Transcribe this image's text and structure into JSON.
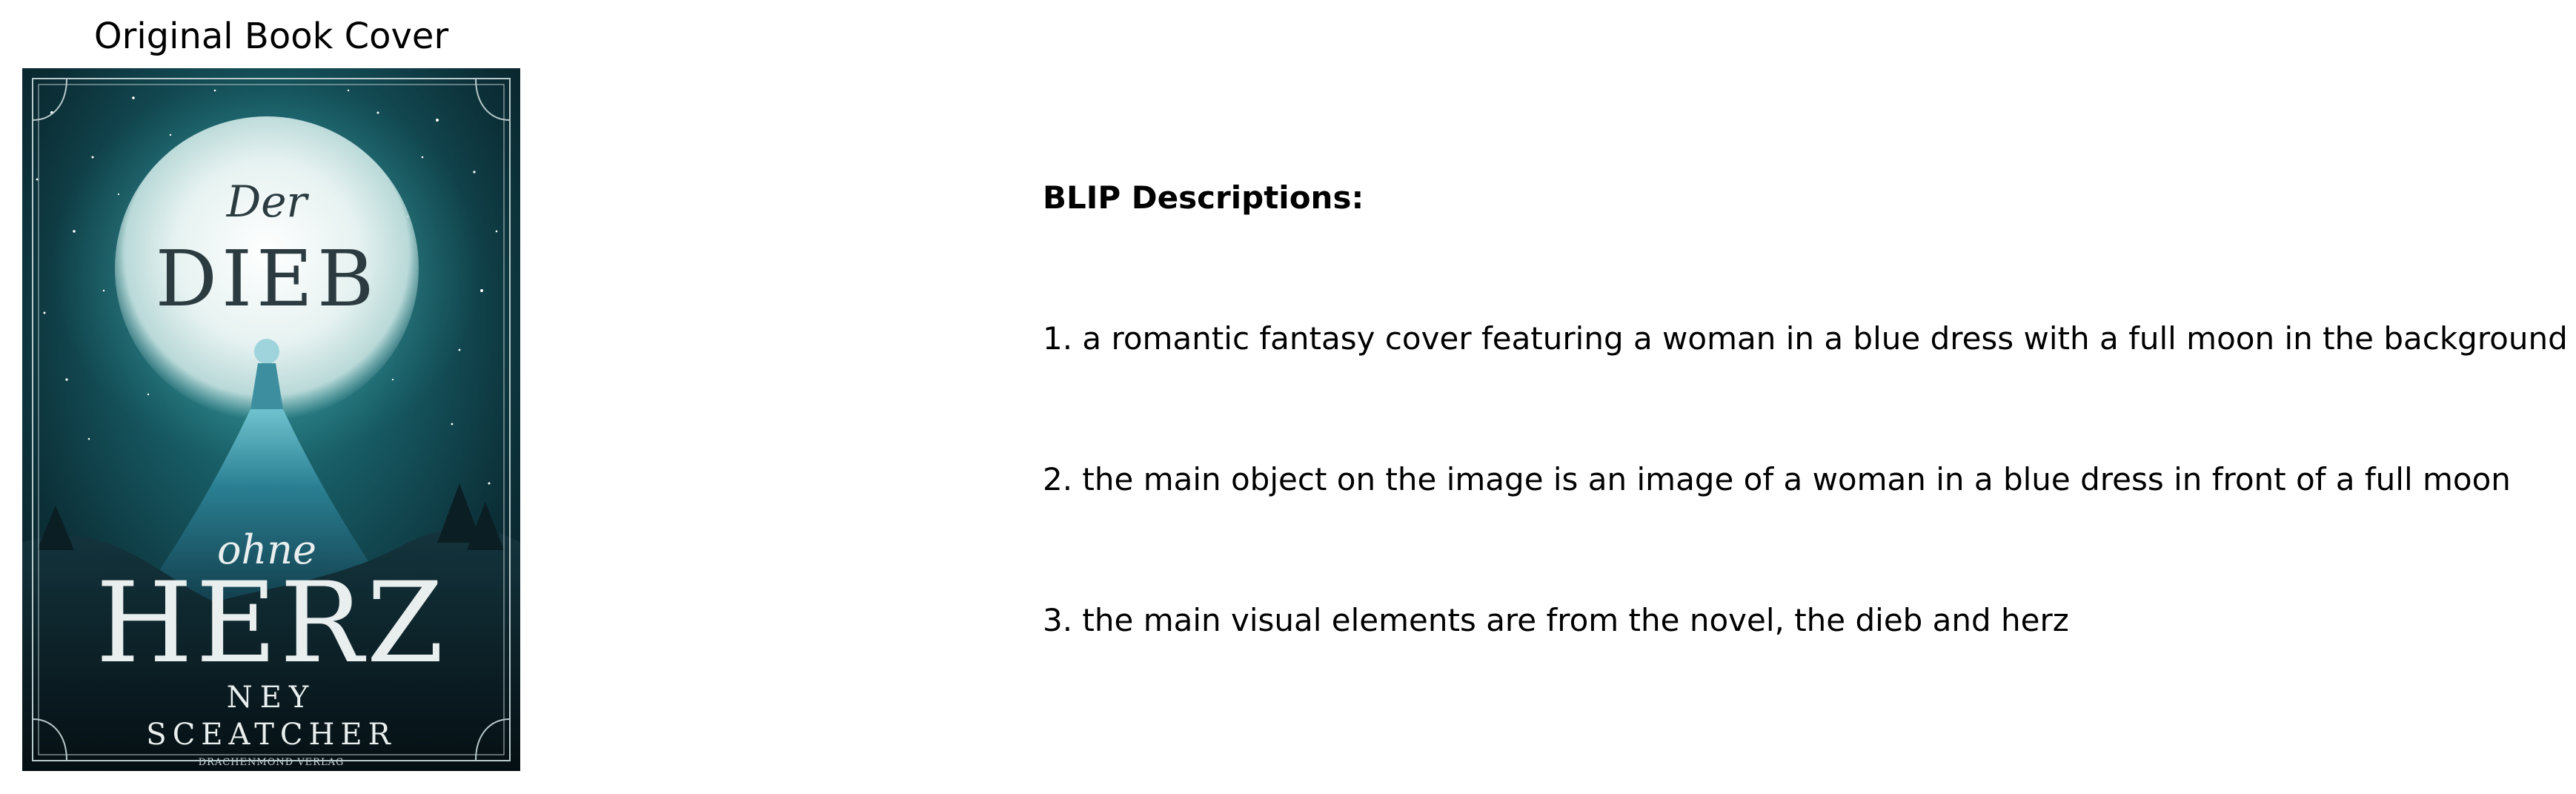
{
  "cover_panel": {
    "title": "Original Book Cover",
    "cover": {
      "title_small": "Der",
      "title_main": "DIEB",
      "title_connector": "ohne",
      "title_large": "HERZ",
      "author_first": "NEY",
      "author_last": "SCEATCHER",
      "publisher": "DRACHENMOND VERLAG",
      "colors": {
        "background": "#0b2730",
        "teal": "#1c6f78",
        "moon": "#eaf3f2",
        "text_light": "#e9eeee",
        "text_dark": "#2b3b40"
      }
    }
  },
  "descriptions": {
    "heading": "BLIP Descriptions:",
    "items": [
      "1. a romantic fantasy cover featuring a woman in a blue dress with a full moon in the background",
      "2. the main object on the image is an image of a woman in a blue dress in front of a full moon",
      "3. the main visual elements are from the novel, the dieb and herz"
    ]
  }
}
